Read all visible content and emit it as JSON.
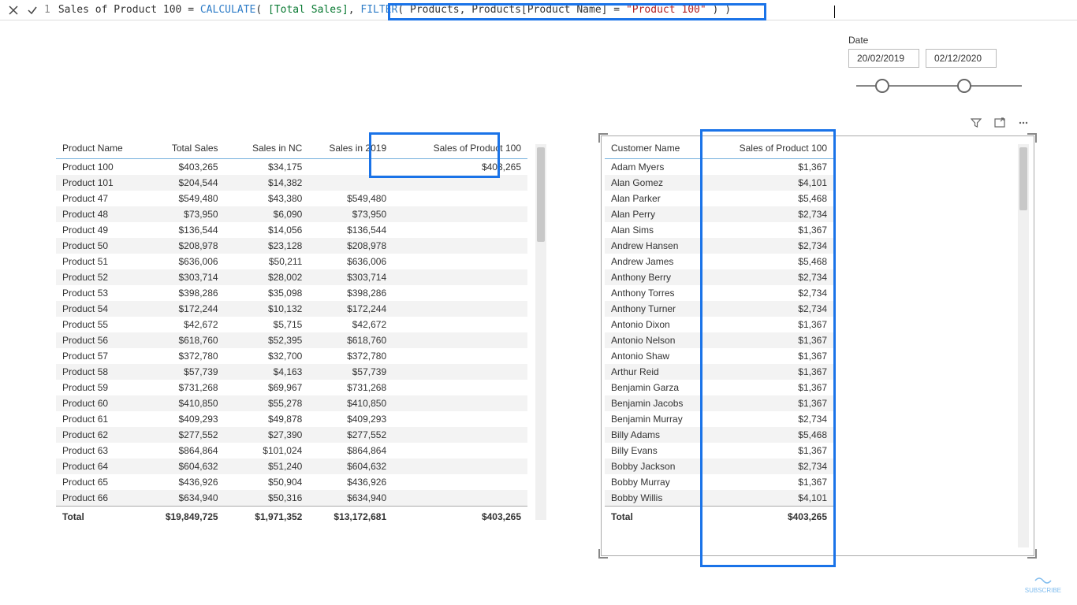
{
  "formula": {
    "line": "1",
    "measure_name": "Sales of Product 100",
    "eq": "=",
    "fn_calculate": "CALCULATE",
    "open1": "(",
    "arg_total_sales": "[Total Sales]",
    "comma1": ",",
    "fn_filter": "FILTER",
    "open2": "(",
    "arg_products": "Products",
    "comma2": ",",
    "arg_col": "Products[Product Name]",
    "eq2": "=",
    "str_val": "\"Product 100\"",
    "close2": ")",
    "close1": ")"
  },
  "slicer": {
    "label": "Date",
    "start": "20/02/2019",
    "end": "02/12/2020"
  },
  "table1": {
    "headers": [
      "Product Name",
      "Total Sales",
      "Sales in NC",
      "Sales in 2019",
      "Sales of Product 100"
    ],
    "rows": [
      [
        "Product 100",
        "$403,265",
        "$34,175",
        "",
        "$403,265"
      ],
      [
        "Product 101",
        "$204,544",
        "$14,382",
        "",
        ""
      ],
      [
        "Product 47",
        "$549,480",
        "$43,380",
        "$549,480",
        ""
      ],
      [
        "Product 48",
        "$73,950",
        "$6,090",
        "$73,950",
        ""
      ],
      [
        "Product 49",
        "$136,544",
        "$14,056",
        "$136,544",
        ""
      ],
      [
        "Product 50",
        "$208,978",
        "$23,128",
        "$208,978",
        ""
      ],
      [
        "Product 51",
        "$636,006",
        "$50,211",
        "$636,006",
        ""
      ],
      [
        "Product 52",
        "$303,714",
        "$28,002",
        "$303,714",
        ""
      ],
      [
        "Product 53",
        "$398,286",
        "$35,098",
        "$398,286",
        ""
      ],
      [
        "Product 54",
        "$172,244",
        "$10,132",
        "$172,244",
        ""
      ],
      [
        "Product 55",
        "$42,672",
        "$5,715",
        "$42,672",
        ""
      ],
      [
        "Product 56",
        "$618,760",
        "$52,395",
        "$618,760",
        ""
      ],
      [
        "Product 57",
        "$372,780",
        "$32,700",
        "$372,780",
        ""
      ],
      [
        "Product 58",
        "$57,739",
        "$4,163",
        "$57,739",
        ""
      ],
      [
        "Product 59",
        "$731,268",
        "$69,967",
        "$731,268",
        ""
      ],
      [
        "Product 60",
        "$410,850",
        "$55,278",
        "$410,850",
        ""
      ],
      [
        "Product 61",
        "$409,293",
        "$49,878",
        "$409,293",
        ""
      ],
      [
        "Product 62",
        "$277,552",
        "$27,390",
        "$277,552",
        ""
      ],
      [
        "Product 63",
        "$864,864",
        "$101,024",
        "$864,864",
        ""
      ],
      [
        "Product 64",
        "$604,632",
        "$51,240",
        "$604,632",
        ""
      ],
      [
        "Product 65",
        "$436,926",
        "$50,904",
        "$436,926",
        ""
      ],
      [
        "Product 66",
        "$634,940",
        "$50,316",
        "$634,940",
        ""
      ]
    ],
    "total": [
      "Total",
      "$19,849,725",
      "$1,971,352",
      "$13,172,681",
      "$403,265"
    ]
  },
  "table2": {
    "headers": [
      "Customer Name",
      "Sales of Product 100"
    ],
    "rows": [
      [
        "Adam Myers",
        "$1,367"
      ],
      [
        "Alan Gomez",
        "$4,101"
      ],
      [
        "Alan Parker",
        "$5,468"
      ],
      [
        "Alan Perry",
        "$2,734"
      ],
      [
        "Alan Sims",
        "$1,367"
      ],
      [
        "Andrew Hansen",
        "$2,734"
      ],
      [
        "Andrew James",
        "$5,468"
      ],
      [
        "Anthony Berry",
        "$2,734"
      ],
      [
        "Anthony Torres",
        "$2,734"
      ],
      [
        "Anthony Turner",
        "$2,734"
      ],
      [
        "Antonio Dixon",
        "$1,367"
      ],
      [
        "Antonio Nelson",
        "$1,367"
      ],
      [
        "Antonio Shaw",
        "$1,367"
      ],
      [
        "Arthur Reid",
        "$1,367"
      ],
      [
        "Benjamin Garza",
        "$1,367"
      ],
      [
        "Benjamin Jacobs",
        "$1,367"
      ],
      [
        "Benjamin Murray",
        "$2,734"
      ],
      [
        "Billy Adams",
        "$5,468"
      ],
      [
        "Billy Evans",
        "$1,367"
      ],
      [
        "Bobby Jackson",
        "$2,734"
      ],
      [
        "Bobby Murray",
        "$1,367"
      ],
      [
        "Bobby Willis",
        "$4,101"
      ]
    ],
    "total": [
      "Total",
      "$403,265"
    ]
  },
  "subscribe": "SUBSCRIBE"
}
